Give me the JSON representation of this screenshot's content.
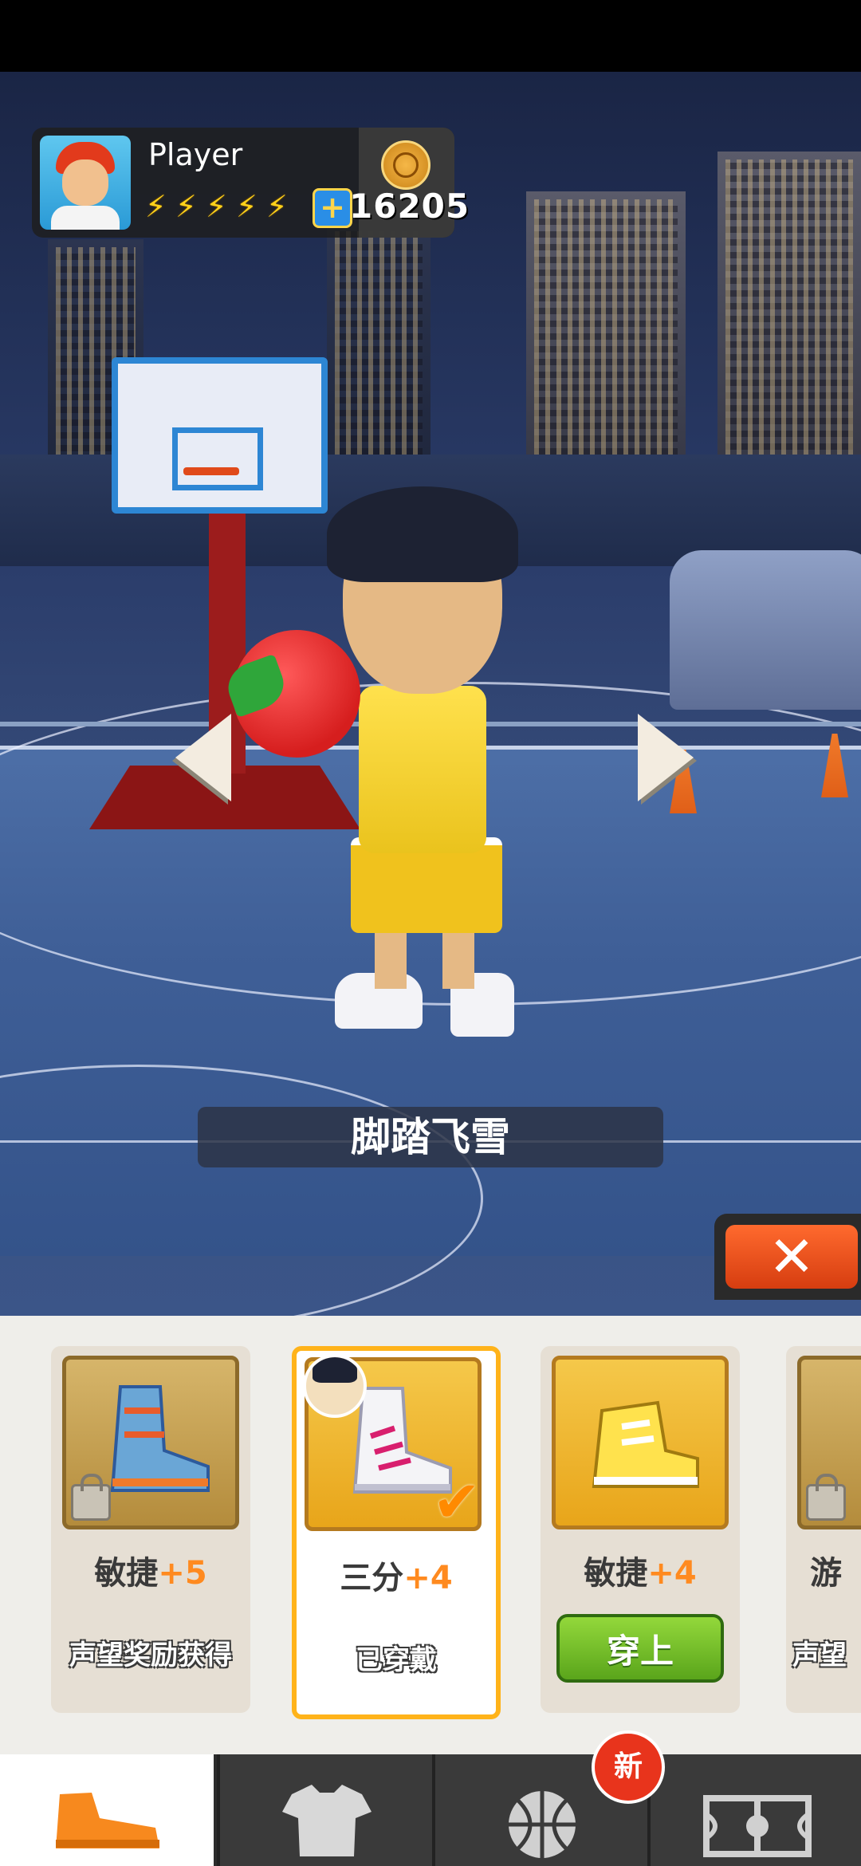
{
  "player": {
    "name": "Player",
    "energy_bolts": 5,
    "coins": "16205"
  },
  "item": {
    "name": "脚踏飞雪"
  },
  "controls": {
    "close_label": "✕"
  },
  "shoes": [
    {
      "stat": "敏捷",
      "bonus": "+5",
      "status": "声望奖励获得",
      "locked": true,
      "selected": false
    },
    {
      "stat": "三分",
      "bonus": "+4",
      "status": "已穿戴",
      "locked": false,
      "selected": true
    },
    {
      "stat": "敏捷",
      "bonus": "+4",
      "button": "穿上",
      "locked": false,
      "selected": false
    },
    {
      "stat": "游",
      "status": "声望",
      "locked": true,
      "selected": false
    }
  ],
  "tabs": [
    {
      "icon": "shoe-icon",
      "active": true
    },
    {
      "icon": "shirt-icon",
      "active": false
    },
    {
      "icon": "basketball-icon",
      "active": false,
      "badge": "新"
    },
    {
      "icon": "court-icon",
      "active": false
    }
  ],
  "colors": {
    "accent_orange": "#ff8a1f",
    "wear_green": "#5aa51b",
    "close_red": "#d63d10",
    "badge_red": "#e8341c"
  }
}
